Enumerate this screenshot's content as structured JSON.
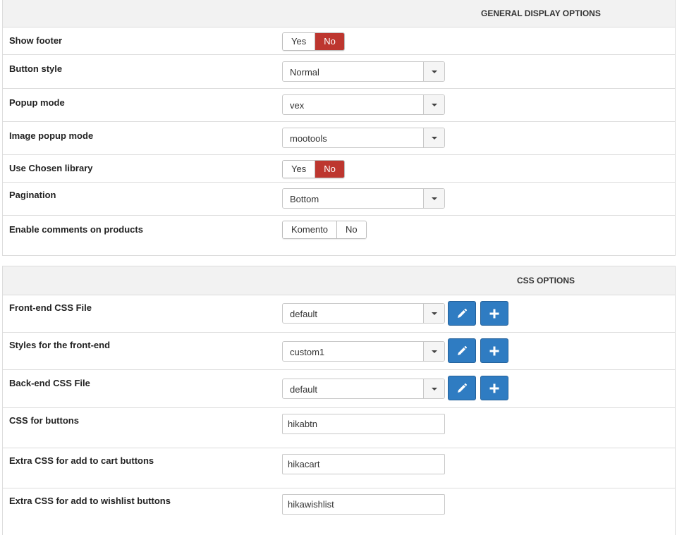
{
  "general": {
    "title": "GENERAL DISPLAY OPTIONS",
    "rows": [
      {
        "label": "Show footer",
        "type": "toggle",
        "options": [
          "Yes",
          "No"
        ],
        "selected": "No"
      },
      {
        "label": "Button style",
        "type": "select",
        "value": "Normal"
      },
      {
        "label": "Popup mode",
        "type": "select",
        "value": "vex"
      },
      {
        "label": "Image popup mode",
        "type": "select",
        "value": "mootools"
      },
      {
        "label": "Use Chosen library",
        "type": "toggle",
        "options": [
          "Yes",
          "No"
        ],
        "selected": "No"
      },
      {
        "label": "Pagination",
        "type": "select",
        "value": "Bottom"
      },
      {
        "label": "Enable comments on products",
        "type": "toggle",
        "options": [
          "Komento",
          "No"
        ],
        "selected": "none"
      }
    ]
  },
  "css": {
    "title": "CSS OPTIONS",
    "rows": [
      {
        "label": "Front-end CSS File",
        "type": "select",
        "value": "default",
        "buttons": [
          "pencil-icon",
          "plus-icon"
        ]
      },
      {
        "label": "Styles for the front-end",
        "type": "select",
        "value": "custom1",
        "buttons": [
          "pencil-icon",
          "plus-icon"
        ]
      },
      {
        "label": "Back-end CSS File",
        "type": "select",
        "value": "default",
        "buttons": [
          "pencil-icon",
          "plus-icon"
        ]
      },
      {
        "label": "CSS for buttons",
        "type": "input",
        "value": "hikabtn"
      },
      {
        "label": "Extra CSS for add to cart buttons",
        "type": "input",
        "value": "hikacart"
      },
      {
        "label": "Extra CSS for add to wishlist buttons",
        "type": "input",
        "value": "hikawishlist"
      }
    ]
  },
  "colors": {
    "active_toggle": "#bd362f",
    "icon_button": "#2f7cc2",
    "header_bg": "#f2f2f2"
  }
}
